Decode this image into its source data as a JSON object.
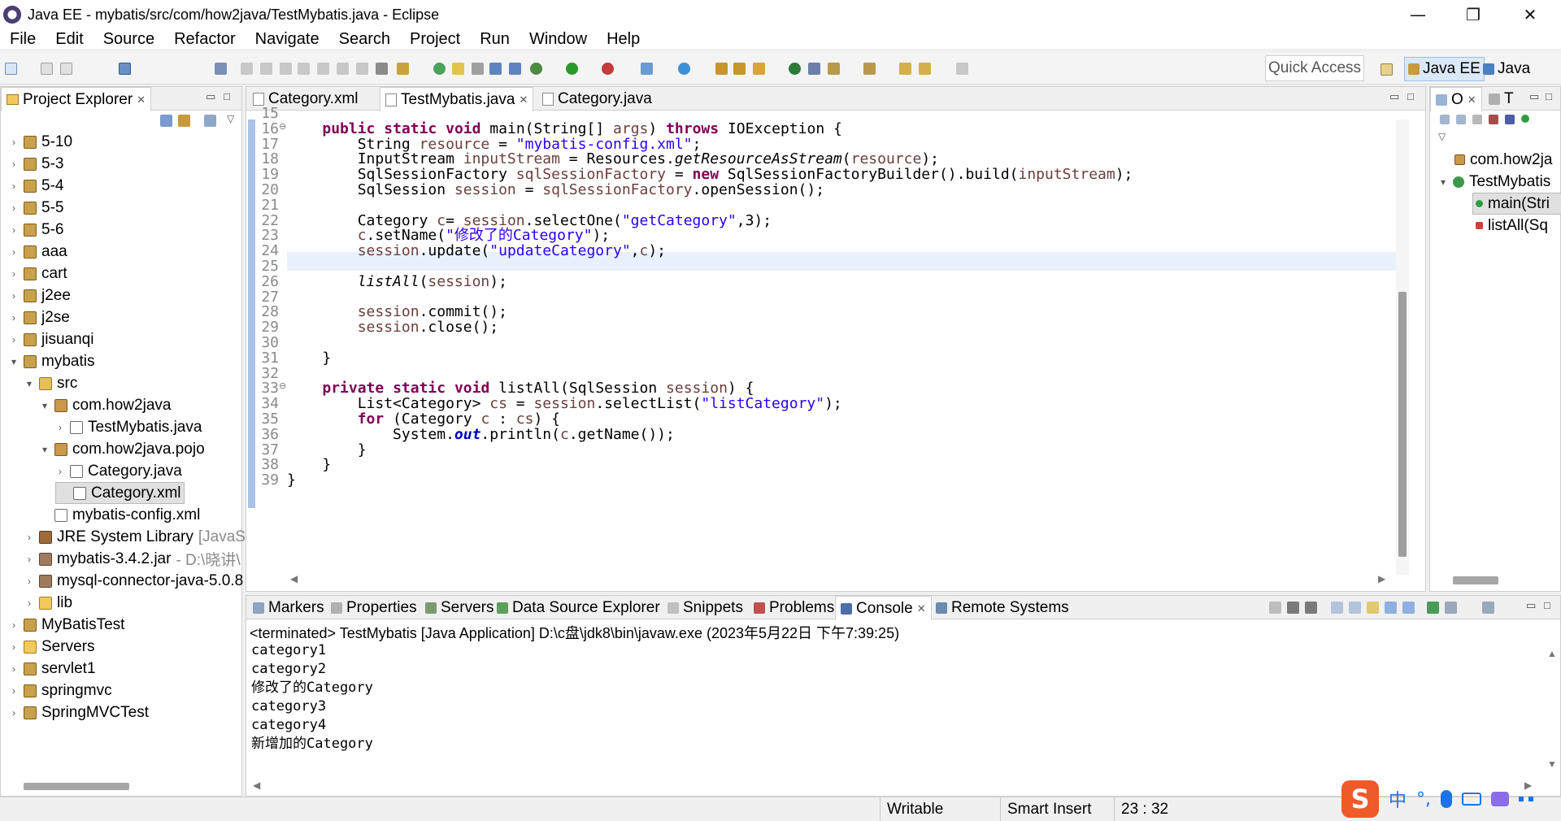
{
  "window": {
    "title": "Java EE - mybatis/src/com/how2java/TestMybatis.java - Eclipse",
    "minimize": "—",
    "maximize": "❐",
    "close": "✕"
  },
  "menu": [
    "File",
    "Edit",
    "Source",
    "Refactor",
    "Navigate",
    "Search",
    "Project",
    "Run",
    "Window",
    "Help"
  ],
  "toolbar": {
    "quick_access": "Quick Access",
    "perspective_active": "Java EE",
    "perspective_other": "Java"
  },
  "project_explorer": {
    "title": "Project Explorer",
    "items": [
      {
        "label": "5-10",
        "icon": "project-icon"
      },
      {
        "label": "5-3",
        "icon": "project-icon"
      },
      {
        "label": "5-4",
        "icon": "project-icon"
      },
      {
        "label": "5-5",
        "icon": "project-icon"
      },
      {
        "label": "5-6",
        "icon": "project-icon"
      },
      {
        "label": "aaa",
        "icon": "project-icon"
      },
      {
        "label": "cart",
        "icon": "project-icon"
      },
      {
        "label": "j2ee",
        "icon": "project-icon"
      },
      {
        "label": "j2se",
        "icon": "project-icon"
      },
      {
        "label": "jisuanqi",
        "icon": "project-icon"
      },
      {
        "label": "mybatis",
        "icon": "project-icon"
      },
      {
        "label": "src",
        "icon": "source-folder-icon"
      },
      {
        "label": "com.how2java",
        "icon": "package-icon"
      },
      {
        "label": "TestMybatis.java",
        "icon": "java-file-icon"
      },
      {
        "label": "com.how2java.pojo",
        "icon": "package-icon"
      },
      {
        "label": "Category.java",
        "icon": "java-file-icon"
      },
      {
        "label": "Category.xml",
        "icon": "xml-file-icon"
      },
      {
        "label": "mybatis-config.xml",
        "icon": "xml-file-icon"
      },
      {
        "label": "JRE System Library",
        "suffix": "[JavaSE",
        "icon": "library-icon"
      },
      {
        "label": "mybatis-3.4.2.jar",
        "suffix": "- D:\\晓讲\\",
        "icon": "jar-icon"
      },
      {
        "label": "mysql-connector-java-5.0.8",
        "icon": "jar-icon"
      },
      {
        "label": "lib",
        "icon": "folder-icon"
      },
      {
        "label": "MyBatisTest",
        "icon": "project-icon"
      },
      {
        "label": "Servers",
        "icon": "folder-icon"
      },
      {
        "label": "servlet1",
        "icon": "project-icon"
      },
      {
        "label": "springmvc",
        "icon": "project-icon"
      },
      {
        "label": "SpringMVCTest",
        "icon": "project-icon"
      }
    ]
  },
  "editor": {
    "tabs": [
      "Category.xml",
      "TestMybatis.java",
      "Category.java"
    ],
    "active_tab": "TestMybatis.java",
    "line_numbers": [
      "15",
      "16",
      "17",
      "18",
      "19",
      "20",
      "21",
      "22",
      "23",
      "24",
      "25",
      "26",
      "27",
      "28",
      "29",
      "30",
      "31",
      "32",
      "33",
      "34",
      "35",
      "36",
      "37",
      "38",
      "39"
    ],
    "lines": [
      "",
      "    public static void main(String[] args) throws IOException {",
      "        String resource = \"mybatis-config.xml\";",
      "        InputStream inputStream = Resources.getResourceAsStream(resource);",
      "        SqlSessionFactory sqlSessionFactory = new SqlSessionFactoryBuilder().build(inputStream);",
      "        SqlSession session = sqlSessionFactory.openSession();",
      "",
      "        Category c= session.selectOne(\"getCategory\",3);",
      "        c.setName(\"修改了的Category\");",
      "        session.update(\"updateCategory\",c);",
      "",
      "        listAll(session);",
      "",
      "        session.commit();",
      "        session.close();",
      "",
      "    }",
      "",
      "    private static void listAll(SqlSession session) {",
      "        List<Category> cs = session.selectList(\"listCategory\");",
      "        for (Category c : cs) {",
      "            System.out.println(c.getName());",
      "        }",
      "    }",
      "}"
    ]
  },
  "outline": {
    "tabs": [
      "O",
      "T"
    ],
    "items": [
      "com.how2ja",
      "TestMybatis",
      "main(Stri",
      "listAll(Sq"
    ]
  },
  "bottom_panel": {
    "tabs": [
      "Markers",
      "Properties",
      "Servers",
      "Data Source Explorer",
      "Snippets",
      "Problems",
      "Console",
      "Remote Systems"
    ],
    "active_tab": "Console",
    "header": "<terminated> TestMybatis [Java Application] D:\\c盘\\jdk8\\bin\\javaw.exe (2023年5月22日 下午7:39:25)",
    "output": [
      "category1",
      "category2",
      "修改了的Category",
      "category3",
      "category4",
      "新增加的Category"
    ]
  },
  "status": {
    "writable": "Writable",
    "insert_mode": "Smart Insert",
    "position": "23 : 32"
  },
  "ime": {
    "logo": "S",
    "lang": "中",
    "punct": "°,",
    "mic": "mic-icon",
    "keyboard": "keyboard-icon"
  }
}
